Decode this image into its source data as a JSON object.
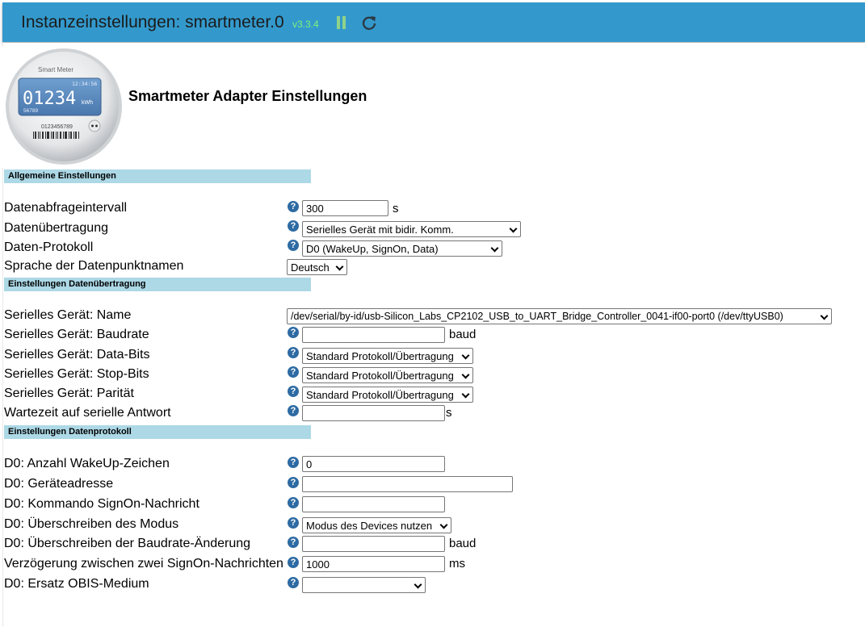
{
  "header": {
    "title": "Instanzeinstellungen: smartmeter.0",
    "version": "v3.3.4",
    "accent_color": "#3399cc",
    "version_color": "#7df27d"
  },
  "logo": {
    "brand": "Smart Meter",
    "time": "12:34:56",
    "reading": "01234",
    "unit": "kWh",
    "sub_number": "56789",
    "serial": "0123456789"
  },
  "main": {
    "heading": "Smartmeter Adapter Einstellungen",
    "sections": {
      "general": "Allgemeine Einstellungen",
      "transfer": "Einstellungen Datenübertragung",
      "protocol": "Einstellungen Datenprotokoll"
    }
  },
  "general": {
    "interval": {
      "label": "Datenabfrageintervall",
      "value": "300",
      "unit": "s"
    },
    "transfer": {
      "label": "Datenübertragung",
      "value": "Serielles Gerät mit bidir. Komm."
    },
    "protocol": {
      "label": "Daten-Protokoll",
      "value": "D0 (WakeUp, SignOn, Data)"
    },
    "language": {
      "label": "Sprache der Datenpunktnamen",
      "value": "Deutsch"
    }
  },
  "serial": {
    "name": {
      "label": "Serielles Gerät: Name",
      "value": "/dev/serial/by-id/usb-Silicon_Labs_CP2102_USB_to_UART_Bridge_Controller_0041-if00-port0 (/dev/ttyUSB0)"
    },
    "baudrate": {
      "label": "Serielles Gerät: Baudrate",
      "value": "",
      "unit": "baud"
    },
    "databits": {
      "label": "Serielles Gerät: Data-Bits",
      "value": "Standard Protokoll/Übertragung"
    },
    "stopbits": {
      "label": "Serielles Gerät: Stop-Bits",
      "value": "Standard Protokoll/Übertragung"
    },
    "parity": {
      "label": "Serielles Gerät: Parität",
      "value": "Standard Protokoll/Übertragung"
    },
    "timeout": {
      "label": "Wartezeit auf serielle Antwort",
      "value": "",
      "unit": "s"
    }
  },
  "d0": {
    "wakeup": {
      "label": "D0: Anzahl WakeUp-Zeichen",
      "value": "0"
    },
    "address": {
      "label": "D0: Geräteadresse",
      "value": ""
    },
    "signon": {
      "label": "D0: Kommando SignOn-Nachricht",
      "value": ""
    },
    "mode": {
      "label": "D0: Überschreiben des Modus",
      "value": "Modus des Devices nutzen"
    },
    "baudchange": {
      "label": "D0: Überschreiben der Baudrate-Änderung",
      "value": "",
      "unit": "baud"
    },
    "delay": {
      "label": "Verzögerung zwischen zwei SignOn-Nachrichten",
      "value": "1000",
      "unit": "ms"
    },
    "obis": {
      "label": "D0: Ersatz OBIS-Medium",
      "value": ""
    }
  },
  "help_glyph": "?"
}
